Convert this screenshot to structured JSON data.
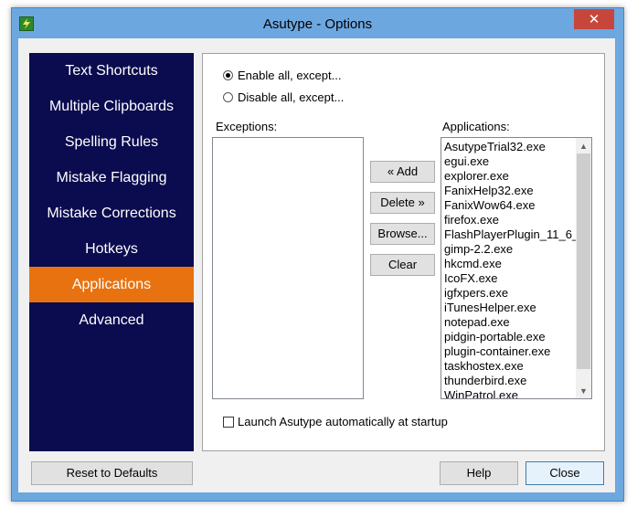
{
  "window": {
    "title": "Asutype - Options",
    "close_glyph": "✕"
  },
  "nav": {
    "items": [
      {
        "label": "Text Shortcuts"
      },
      {
        "label": "Multiple Clipboards"
      },
      {
        "label": "Spelling Rules"
      },
      {
        "label": "Mistake Flagging"
      },
      {
        "label": "Mistake Corrections"
      },
      {
        "label": "Hotkeys"
      },
      {
        "label": "Applications",
        "active": true
      },
      {
        "label": "Advanced"
      }
    ]
  },
  "panel": {
    "radio_enable": "Enable all, except...",
    "radio_disable": "Disable all, except...",
    "selected_mode": "enable",
    "exceptions_label": "Exceptions:",
    "applications_label": "Applications:",
    "applications": [
      "AsutypeTrial32.exe",
      "egui.exe",
      "explorer.exe",
      "FanixHelp32.exe",
      "FanixWow64.exe",
      "firefox.exe",
      "FlashPlayerPlugin_11_6_",
      "gimp-2.2.exe",
      "hkcmd.exe",
      "IcoFX.exe",
      "igfxpers.exe",
      "iTunesHelper.exe",
      "notepad.exe",
      "pidgin-portable.exe",
      "plugin-container.exe",
      "taskhostex.exe",
      "thunderbird.exe",
      "WinPatrol.exe"
    ],
    "add_button": "« Add",
    "delete_button": "Delete »",
    "browse_button": "Browse...",
    "clear_button": "Clear",
    "launch_checkbox": "Launch Asutype automatically at startup",
    "launch_checked": false
  },
  "footer": {
    "reset_button": "Reset to Defaults",
    "help_button": "Help",
    "close_button": "Close"
  },
  "colors": {
    "title_bar": "#6da7e0",
    "nav_background": "#0b0b4f",
    "nav_active": "#e8720f",
    "close_button": "#c7463c"
  }
}
